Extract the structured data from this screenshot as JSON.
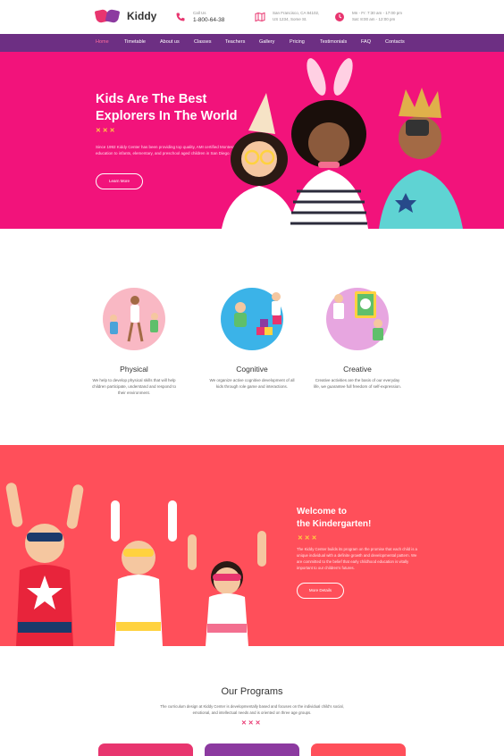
{
  "brand": {
    "name": "Kiddy"
  },
  "header": {
    "phone_label": "Call Us",
    "phone_number": "1-800-64-38",
    "address_line1": "San Francisco, CA 94102,",
    "address_line2": "US 1234, Some St.",
    "hours_line1": "Mn - Fr: 7:30 am - 17:00 pm",
    "hours_line2": "Sat: 8:00 am - 12:00 pm"
  },
  "nav": {
    "items": [
      "Home",
      "Timetable",
      "About us",
      "Classes",
      "Teachers",
      "Gallery",
      "Pricing",
      "Testimonials",
      "FAQ",
      "Contacts"
    ],
    "active_index": 0
  },
  "hero": {
    "title_line1": "Kids Are The Best",
    "title_line2": "Explorers In The World",
    "stars": "✕ ✕ ✕",
    "text": "Since 1992 Kiddy Center has been providing top quality, AMI certified Montessori education to infants, elementary, and preschool aged children in San Diego.",
    "button": "Learn More"
  },
  "features": [
    {
      "title": "Physical",
      "text": "We help to develop physical skills that will help children participate, understand and respond to their environment."
    },
    {
      "title": "Cognitive",
      "text": "We organize active cognitive development of all kids through role game and interactions."
    },
    {
      "title": "Creative",
      "text": "Creative activities are the basis of our everyday life, we guarantee full freedom of self-expression."
    }
  ],
  "welcome": {
    "title_line1": "Welcome to",
    "title_line2": "the Kindergarten!",
    "stars": "✕ ✕ ✕",
    "text": "The Kiddy Center builds its program on the promise that each child is a unique individual with a definite growth and developmental pattern. We are committed to the belief that early childhood education is vitally important to our children's futures.",
    "button": "More Details"
  },
  "programs": {
    "title": "Our Programs",
    "text": "The curriculum design at Kiddy Center is developmentally based and focuses on the individual child's social, emotional, and intellectual needs and is oriented on three age groups.",
    "stars": "✕ ✕ ✕"
  },
  "colors": {
    "nav": "#6d2f83",
    "hero": "#f2137b",
    "welcome": "#ff4f5a",
    "accent_pink": "#e8356f",
    "accent_purple": "#8c3aa0",
    "star_yellow": "#ffd23f"
  },
  "icons": {
    "phone": "phone-icon",
    "address": "map-icon",
    "hours": "clock-icon"
  }
}
